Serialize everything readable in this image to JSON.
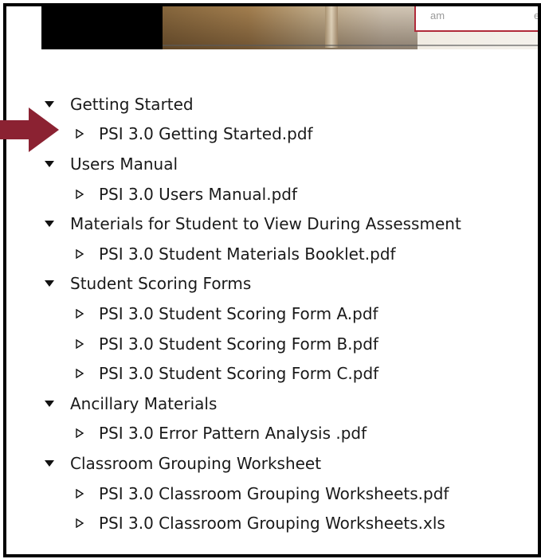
{
  "banner": {
    "card_text_left": "am",
    "card_text_right": "ed"
  },
  "colors": {
    "arrow": "#8b2232",
    "text": "#1a1a1a",
    "frame": "#000000"
  },
  "tree": [
    {
      "label": "Getting Started",
      "expanded": true,
      "files": [
        "PSI 3.0 Getting Started.pdf"
      ]
    },
    {
      "label": "Users Manual",
      "expanded": true,
      "files": [
        "PSI 3.0 Users Manual.pdf"
      ]
    },
    {
      "label": "Materials for Student to View During Assessment",
      "expanded": true,
      "files": [
        "PSI 3.0 Student Materials Booklet.pdf"
      ]
    },
    {
      "label": "Student Scoring Forms",
      "expanded": true,
      "files": [
        "PSI 3.0 Student Scoring Form A.pdf",
        "PSI 3.0 Student Scoring Form B.pdf",
        "PSI 3.0 Student Scoring Form C.pdf"
      ]
    },
    {
      "label": "Ancillary Materials",
      "expanded": true,
      "files": [
        "PSI 3.0 Error Pattern Analysis .pdf"
      ]
    },
    {
      "label": "Classroom Grouping Worksheet",
      "expanded": true,
      "files": [
        "PSI 3.0 Classroom Grouping Worksheets.pdf",
        "PSI 3.0 Classroom Grouping Worksheets.xls"
      ]
    }
  ],
  "icons": {
    "folder_toggle": "triangle-down-icon",
    "file_toggle": "triangle-right-outline-icon",
    "callout": "arrow-right-icon"
  }
}
